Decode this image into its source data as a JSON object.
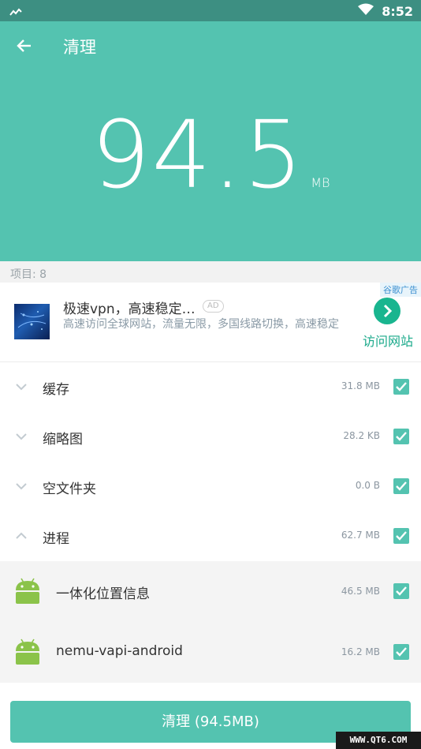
{
  "status_bar": {
    "time": "8:52"
  },
  "header": {
    "title": "清理"
  },
  "summary": {
    "amount": "94.5",
    "unit": "MB"
  },
  "items_label": "项目: 8",
  "ad": {
    "badge": "谷歌广告",
    "title": "极速vpn，高速稳定…",
    "tag": "AD",
    "description": "高速访问全球网站，流量无限，多国线路切换，高速稳定",
    "action_label": "访问网站"
  },
  "categories": [
    {
      "label": "缓存",
      "size": "31.8 MB",
      "checked": true
    },
    {
      "label": "缩略图",
      "size": "28.2 KB",
      "checked": true
    },
    {
      "label": "空文件夹",
      "size": "0.0 B",
      "checked": true
    },
    {
      "label": "进程",
      "size": "62.7 MB",
      "checked": true
    }
  ],
  "processes": [
    {
      "label": "一体化位置信息",
      "size": "46.5 MB",
      "checked": true
    },
    {
      "label": "nemu-vapi-android",
      "size": "16.2 MB",
      "checked": true
    }
  ],
  "clean_button": {
    "label": "清理 (94.5MB)"
  },
  "watermark": "WWW.QT6.COM",
  "colors": {
    "accent": "#54c3b0",
    "status_bar": "#3d8f82",
    "ad_green": "#19b58f"
  }
}
